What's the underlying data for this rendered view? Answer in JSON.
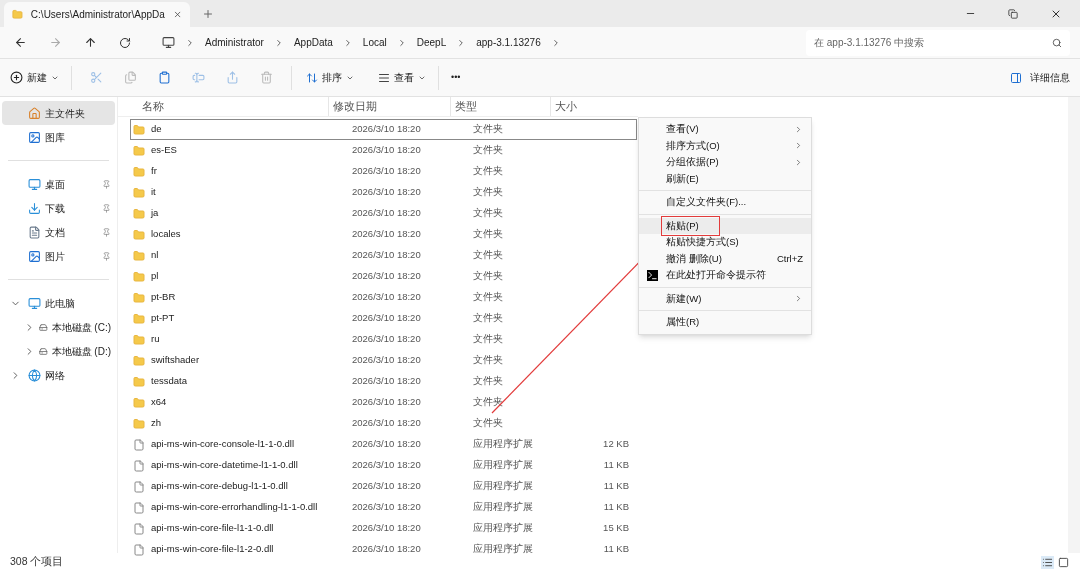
{
  "tab": {
    "title": "C:\\Users\\Administrator\\AppDa"
  },
  "breadcrumb": [
    "Administrator",
    "AppData",
    "Local",
    "DeepL",
    "app-3.1.13276"
  ],
  "search": {
    "placeholder": "在 app-3.1.13276 中搜索"
  },
  "toolbar": {
    "new": "新建",
    "sort": "排序",
    "view": "查看",
    "more": "•••",
    "details": "详细信息"
  },
  "sidebar": {
    "items": [
      {
        "label": "主文件夹",
        "kind": "home",
        "selected": true,
        "pinned": false
      },
      {
        "label": "图库",
        "kind": "gallery",
        "selected": false,
        "pinned": false
      },
      {
        "kind": "separator"
      },
      {
        "label": "桌面",
        "kind": "desktop",
        "selected": false,
        "pinned": true
      },
      {
        "label": "下载",
        "kind": "download",
        "selected": false,
        "pinned": true
      },
      {
        "label": "文档",
        "kind": "document",
        "selected": false,
        "pinned": true
      },
      {
        "label": "图片",
        "kind": "gallery",
        "selected": false,
        "pinned": true
      },
      {
        "kind": "separator"
      },
      {
        "label": "此电脑",
        "kind": "pc",
        "selected": false,
        "expanded": true,
        "children": [
          {
            "label": "本地磁盘 (C:)",
            "kind": "drive",
            "selected": false,
            "expanded": false
          },
          {
            "label": "本地磁盘 (D:)",
            "kind": "drive",
            "selected": false,
            "expanded": false
          }
        ]
      },
      {
        "label": "网络",
        "kind": "network",
        "selected": false,
        "expanded": false
      }
    ]
  },
  "table": {
    "columns": [
      "名称",
      "修改日期",
      "类型",
      "大小"
    ],
    "rows": [
      {
        "kind": "folder",
        "name": "de",
        "date": "2026/3/10 18:20",
        "type": "文件夹",
        "focused": true
      },
      {
        "kind": "folder",
        "name": "es-ES",
        "date": "2026/3/10 18:20",
        "type": "文件夹",
        "focused": false
      },
      {
        "kind": "folder",
        "name": "fr",
        "date": "2026/3/10 18:20",
        "type": "文件夹",
        "focused": false
      },
      {
        "kind": "folder",
        "name": "it",
        "date": "2026/3/10 18:20",
        "type": "文件夹",
        "focused": false
      },
      {
        "kind": "folder",
        "name": "ja",
        "date": "2026/3/10 18:20",
        "type": "文件夹",
        "focused": false
      },
      {
        "kind": "folder",
        "name": "locales",
        "date": "2026/3/10 18:20",
        "type": "文件夹",
        "focused": false
      },
      {
        "kind": "folder",
        "name": "nl",
        "date": "2026/3/10 18:20",
        "type": "文件夹",
        "focused": false
      },
      {
        "kind": "folder",
        "name": "pl",
        "date": "2026/3/10 18:20",
        "type": "文件夹",
        "focused": false
      },
      {
        "kind": "folder",
        "name": "pt-BR",
        "date": "2026/3/10 18:20",
        "type": "文件夹",
        "focused": false
      },
      {
        "kind": "folder",
        "name": "pt-PT",
        "date": "2026/3/10 18:20",
        "type": "文件夹",
        "focused": false
      },
      {
        "kind": "folder",
        "name": "ru",
        "date": "2026/3/10 18:20",
        "type": "文件夹",
        "focused": false
      },
      {
        "kind": "folder",
        "name": "swiftshader",
        "date": "2026/3/10 18:20",
        "type": "文件夹",
        "focused": false
      },
      {
        "kind": "folder",
        "name": "tessdata",
        "date": "2026/3/10 18:20",
        "type": "文件夹",
        "focused": false
      },
      {
        "kind": "folder",
        "name": "x64",
        "date": "2026/3/10 18:20",
        "type": "文件夹",
        "focused": false
      },
      {
        "kind": "folder",
        "name": "zh",
        "date": "2026/3/10 18:20",
        "type": "文件夹",
        "focused": false
      },
      {
        "kind": "file",
        "name": "api-ms-win-core-console-l1-1-0.dll",
        "date": "2026/3/10 18:20",
        "type": "应用程序扩展",
        "size": "12 KB",
        "focused": false
      },
      {
        "kind": "file",
        "name": "api-ms-win-core-datetime-l1-1-0.dll",
        "date": "2026/3/10 18:20",
        "type": "应用程序扩展",
        "size": "11 KB",
        "focused": false
      },
      {
        "kind": "file",
        "name": "api-ms-win-core-debug-l1-1-0.dll",
        "date": "2026/3/10 18:20",
        "type": "应用程序扩展",
        "size": "11 KB",
        "focused": false
      },
      {
        "kind": "file",
        "name": "api-ms-win-core-errorhandling-l1-1-0.dll",
        "date": "2026/3/10 18:20",
        "type": "应用程序扩展",
        "size": "11 KB",
        "focused": false
      },
      {
        "kind": "file",
        "name": "api-ms-win-core-file-l1-1-0.dll",
        "date": "2026/3/10 18:20",
        "type": "应用程序扩展",
        "size": "15 KB",
        "focused": false
      },
      {
        "kind": "file",
        "name": "api-ms-win-core-file-l1-2-0.dll",
        "date": "2026/3/10 18:20",
        "type": "应用程序扩展",
        "size": "11 KB",
        "focused": false
      }
    ]
  },
  "context_menu": {
    "items": [
      {
        "kind": "item",
        "label": "查看(V)",
        "submenu": true,
        "selected": false,
        "outlined": false
      },
      {
        "kind": "item",
        "label": "排序方式(O)",
        "submenu": true,
        "selected": false,
        "outlined": false
      },
      {
        "kind": "item",
        "label": "分组依据(P)",
        "submenu": true,
        "selected": false,
        "outlined": false
      },
      {
        "kind": "item",
        "label": "刷新(E)",
        "submenu": false,
        "selected": false,
        "outlined": false
      },
      {
        "kind": "separator"
      },
      {
        "kind": "item",
        "label": "自定义文件夹(F)...",
        "submenu": false,
        "selected": false,
        "outlined": false
      },
      {
        "kind": "separator"
      },
      {
        "kind": "item",
        "label": "粘贴(P)",
        "submenu": false,
        "selected": true,
        "outlined": true
      },
      {
        "kind": "item",
        "label": "粘贴快捷方式(S)",
        "submenu": false,
        "selected": false,
        "outlined": false
      },
      {
        "kind": "item",
        "label": "撤消 删除(U)",
        "shortcut": "Ctrl+Z",
        "submenu": false,
        "selected": false,
        "outlined": false
      },
      {
        "kind": "command",
        "label": "在此处打开命令提示符",
        "submenu": false,
        "selected": false,
        "outlined": false
      },
      {
        "kind": "separator"
      },
      {
        "kind": "item",
        "label": "新建(W)",
        "submenu": true,
        "selected": false,
        "outlined": false
      },
      {
        "kind": "separator"
      },
      {
        "kind": "item",
        "label": "属性(R)",
        "submenu": false,
        "selected": false,
        "outlined": false
      }
    ]
  },
  "status_bar": {
    "count": "308 个项目",
    "views": [
      {
        "kind": "details",
        "selected": true
      },
      {
        "kind": "tiles",
        "selected": false
      }
    ]
  }
}
